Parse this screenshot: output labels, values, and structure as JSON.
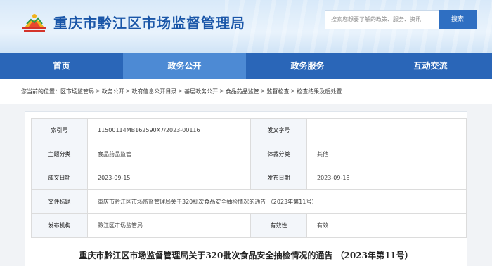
{
  "header": {
    "site_title": "重庆市黔江区市场监督管理局",
    "search_placeholder": "搜索您想要了解的政策、服务、资讯",
    "search_button": "搜索"
  },
  "nav": {
    "items": [
      {
        "label": "首页",
        "active": false
      },
      {
        "label": "政务公开",
        "active": true
      },
      {
        "label": "政务服务",
        "active": false
      },
      {
        "label": "互动交流",
        "active": false
      }
    ]
  },
  "breadcrumb": {
    "prefix": "您当前的位置：",
    "items": [
      "区市场监管局",
      "政务公开",
      "政府信息公开目录",
      "基层政务公开",
      "食品药品监管",
      "监督检查",
      "检查结果及后处置"
    ],
    "separator": ">"
  },
  "info": {
    "index_label": "索引号",
    "index_value": "11500114MB162590X7/2023-00116",
    "doc_no_label": "发文字号",
    "doc_no_value": "",
    "topic_label": "主题分类",
    "topic_value": "食品药品监管",
    "genre_label": "体裁分类",
    "genre_value": "其他",
    "created_label": "成文日期",
    "created_value": "2023-09-15",
    "published_label": "发布日期",
    "published_value": "2023-09-18",
    "title_label": "文件标题",
    "title_value": "重庆市黔江区市场监督管理局关于320批次食品安全抽检情况的通告 （2023年第11号）",
    "issuer_label": "发布机构",
    "issuer_value": "黔江区市场监管局",
    "validity_label": "有效性",
    "validity_value": "有效"
  },
  "article": {
    "title": "重庆市黔江区市场监督管理局关于320批次食品安全抽检情况的通告 （2023年第11号）"
  },
  "colors": {
    "nav_bg": "#2a66b8",
    "nav_active": "#4d8ad4",
    "title_blue": "#1a56a8",
    "search_btn": "#2f6fc2"
  }
}
